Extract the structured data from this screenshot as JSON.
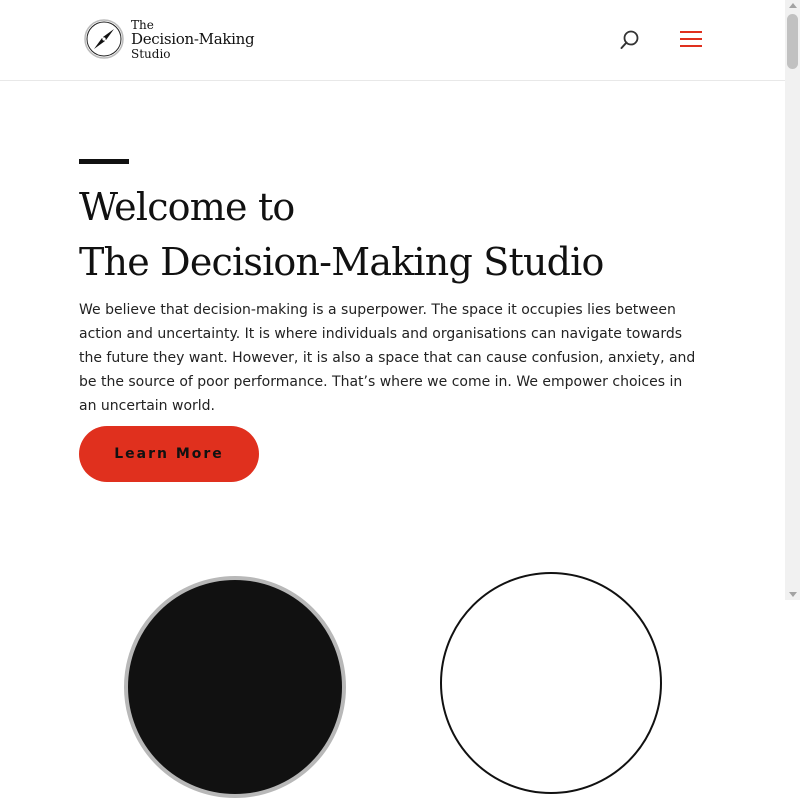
{
  "header": {
    "logo": {
      "line1": "The",
      "line2": "Decision-Making",
      "line3": "Studio"
    }
  },
  "hero": {
    "title_line1": "Welcome to",
    "title_line2": "The Decision-Making Studio",
    "body": "We believe that decision-making is a superpower. The space it occupies lies between action and uncertainty. It is where individuals and organisations can navigate towards the future they want. However, it is also a space that can cause confusion, anxiety, and be the source of poor performance. That’s where we come in. We empower choices in an uncertain world.",
    "cta_label": "Learn More"
  },
  "colors": {
    "accent": "#e0301e",
    "text": "#111111",
    "header_border": "#e8e8e8"
  },
  "icons": {
    "logo": "compass-icon",
    "search": "search-icon",
    "menu": "hamburger-menu-icon"
  }
}
